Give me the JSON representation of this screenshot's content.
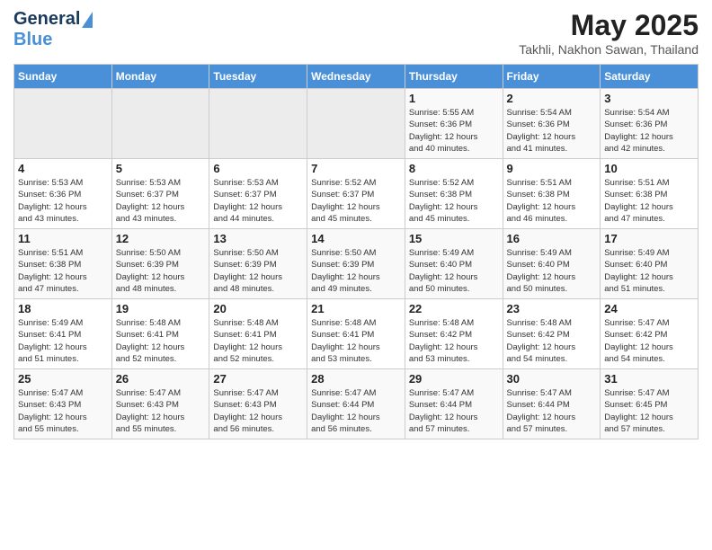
{
  "header": {
    "logo_line1": "General",
    "logo_line2": "Blue",
    "month_title": "May 2025",
    "location": "Takhli, Nakhon Sawan, Thailand"
  },
  "days_of_week": [
    "Sunday",
    "Monday",
    "Tuesday",
    "Wednesday",
    "Thursday",
    "Friday",
    "Saturday"
  ],
  "weeks": [
    [
      {
        "day": "",
        "empty": true
      },
      {
        "day": "",
        "empty": true
      },
      {
        "day": "",
        "empty": true
      },
      {
        "day": "",
        "empty": true
      },
      {
        "day": "1",
        "sunrise": "5:55 AM",
        "sunset": "6:36 PM",
        "daylight": "12 hours and 40 minutes."
      },
      {
        "day": "2",
        "sunrise": "5:54 AM",
        "sunset": "6:36 PM",
        "daylight": "12 hours and 41 minutes."
      },
      {
        "day": "3",
        "sunrise": "5:54 AM",
        "sunset": "6:36 PM",
        "daylight": "12 hours and 42 minutes."
      }
    ],
    [
      {
        "day": "4",
        "sunrise": "5:53 AM",
        "sunset": "6:36 PM",
        "daylight": "12 hours and 43 minutes."
      },
      {
        "day": "5",
        "sunrise": "5:53 AM",
        "sunset": "6:37 PM",
        "daylight": "12 hours and 43 minutes."
      },
      {
        "day": "6",
        "sunrise": "5:53 AM",
        "sunset": "6:37 PM",
        "daylight": "12 hours and 44 minutes."
      },
      {
        "day": "7",
        "sunrise": "5:52 AM",
        "sunset": "6:37 PM",
        "daylight": "12 hours and 45 minutes."
      },
      {
        "day": "8",
        "sunrise": "5:52 AM",
        "sunset": "6:38 PM",
        "daylight": "12 hours and 45 minutes."
      },
      {
        "day": "9",
        "sunrise": "5:51 AM",
        "sunset": "6:38 PM",
        "daylight": "12 hours and 46 minutes."
      },
      {
        "day": "10",
        "sunrise": "5:51 AM",
        "sunset": "6:38 PM",
        "daylight": "12 hours and 47 minutes."
      }
    ],
    [
      {
        "day": "11",
        "sunrise": "5:51 AM",
        "sunset": "6:38 PM",
        "daylight": "12 hours and 47 minutes."
      },
      {
        "day": "12",
        "sunrise": "5:50 AM",
        "sunset": "6:39 PM",
        "daylight": "12 hours and 48 minutes."
      },
      {
        "day": "13",
        "sunrise": "5:50 AM",
        "sunset": "6:39 PM",
        "daylight": "12 hours and 48 minutes."
      },
      {
        "day": "14",
        "sunrise": "5:50 AM",
        "sunset": "6:39 PM",
        "daylight": "12 hours and 49 minutes."
      },
      {
        "day": "15",
        "sunrise": "5:49 AM",
        "sunset": "6:40 PM",
        "daylight": "12 hours and 50 minutes."
      },
      {
        "day": "16",
        "sunrise": "5:49 AM",
        "sunset": "6:40 PM",
        "daylight": "12 hours and 50 minutes."
      },
      {
        "day": "17",
        "sunrise": "5:49 AM",
        "sunset": "6:40 PM",
        "daylight": "12 hours and 51 minutes."
      }
    ],
    [
      {
        "day": "18",
        "sunrise": "5:49 AM",
        "sunset": "6:41 PM",
        "daylight": "12 hours and 51 minutes."
      },
      {
        "day": "19",
        "sunrise": "5:48 AM",
        "sunset": "6:41 PM",
        "daylight": "12 hours and 52 minutes."
      },
      {
        "day": "20",
        "sunrise": "5:48 AM",
        "sunset": "6:41 PM",
        "daylight": "12 hours and 52 minutes."
      },
      {
        "day": "21",
        "sunrise": "5:48 AM",
        "sunset": "6:41 PM",
        "daylight": "12 hours and 53 minutes."
      },
      {
        "day": "22",
        "sunrise": "5:48 AM",
        "sunset": "6:42 PM",
        "daylight": "12 hours and 53 minutes."
      },
      {
        "day": "23",
        "sunrise": "5:48 AM",
        "sunset": "6:42 PM",
        "daylight": "12 hours and 54 minutes."
      },
      {
        "day": "24",
        "sunrise": "5:47 AM",
        "sunset": "6:42 PM",
        "daylight": "12 hours and 54 minutes."
      }
    ],
    [
      {
        "day": "25",
        "sunrise": "5:47 AM",
        "sunset": "6:43 PM",
        "daylight": "12 hours and 55 minutes."
      },
      {
        "day": "26",
        "sunrise": "5:47 AM",
        "sunset": "6:43 PM",
        "daylight": "12 hours and 55 minutes."
      },
      {
        "day": "27",
        "sunrise": "5:47 AM",
        "sunset": "6:43 PM",
        "daylight": "12 hours and 56 minutes."
      },
      {
        "day": "28",
        "sunrise": "5:47 AM",
        "sunset": "6:44 PM",
        "daylight": "12 hours and 56 minutes."
      },
      {
        "day": "29",
        "sunrise": "5:47 AM",
        "sunset": "6:44 PM",
        "daylight": "12 hours and 57 minutes."
      },
      {
        "day": "30",
        "sunrise": "5:47 AM",
        "sunset": "6:44 PM",
        "daylight": "12 hours and 57 minutes."
      },
      {
        "day": "31",
        "sunrise": "5:47 AM",
        "sunset": "6:45 PM",
        "daylight": "12 hours and 57 minutes."
      }
    ]
  ],
  "labels": {
    "sunrise": "Sunrise:",
    "sunset": "Sunset:",
    "daylight": "Daylight:"
  }
}
